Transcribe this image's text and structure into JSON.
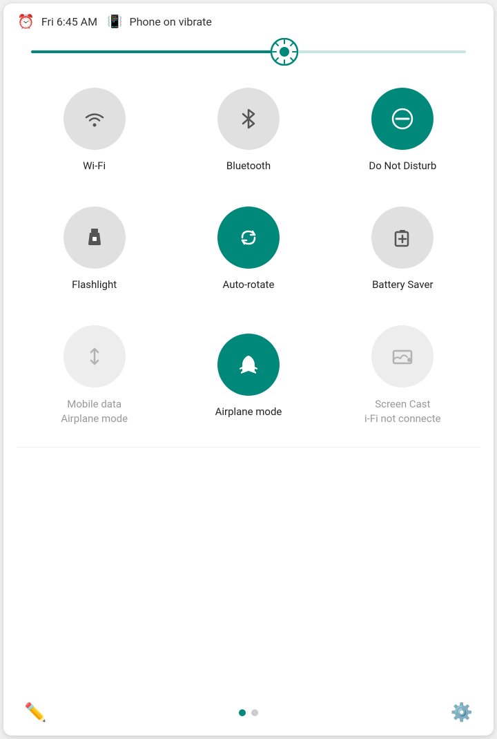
{
  "statusBar": {
    "time": "Fri 6:45 AM",
    "vibrateText": "Phone on vibrate"
  },
  "brightness": {
    "fillPercent": 58
  },
  "row1": [
    {
      "id": "wifi",
      "label": "Wi-Fi",
      "active": false,
      "dimmed": false
    },
    {
      "id": "bluetooth",
      "label": "Bluetooth",
      "active": false,
      "dimmed": false
    },
    {
      "id": "donotdisturb",
      "label": "Do Not Disturb",
      "active": true,
      "dimmed": false
    }
  ],
  "row2": [
    {
      "id": "flashlight",
      "label": "Flashlight",
      "active": false,
      "dimmed": false
    },
    {
      "id": "autorotate",
      "label": "Auto-rotate",
      "active": true,
      "dimmed": false
    },
    {
      "id": "batterysaver",
      "label": "Battery Saver",
      "active": false,
      "dimmed": false
    }
  ],
  "row3": [
    {
      "id": "mobiledata",
      "label": "Mobile data\nAirplane mode",
      "active": false,
      "dimmed": true
    },
    {
      "id": "airplanemode",
      "label": "Airplane mode",
      "active": true,
      "dimmed": false
    },
    {
      "id": "screencast",
      "label": "Screen Cast\ni-Fi not connecte",
      "active": false,
      "dimmed": true
    }
  ],
  "bottomBar": {
    "editLabel": "edit",
    "settingsLabel": "settings",
    "dots": [
      "active",
      "inactive"
    ]
  }
}
